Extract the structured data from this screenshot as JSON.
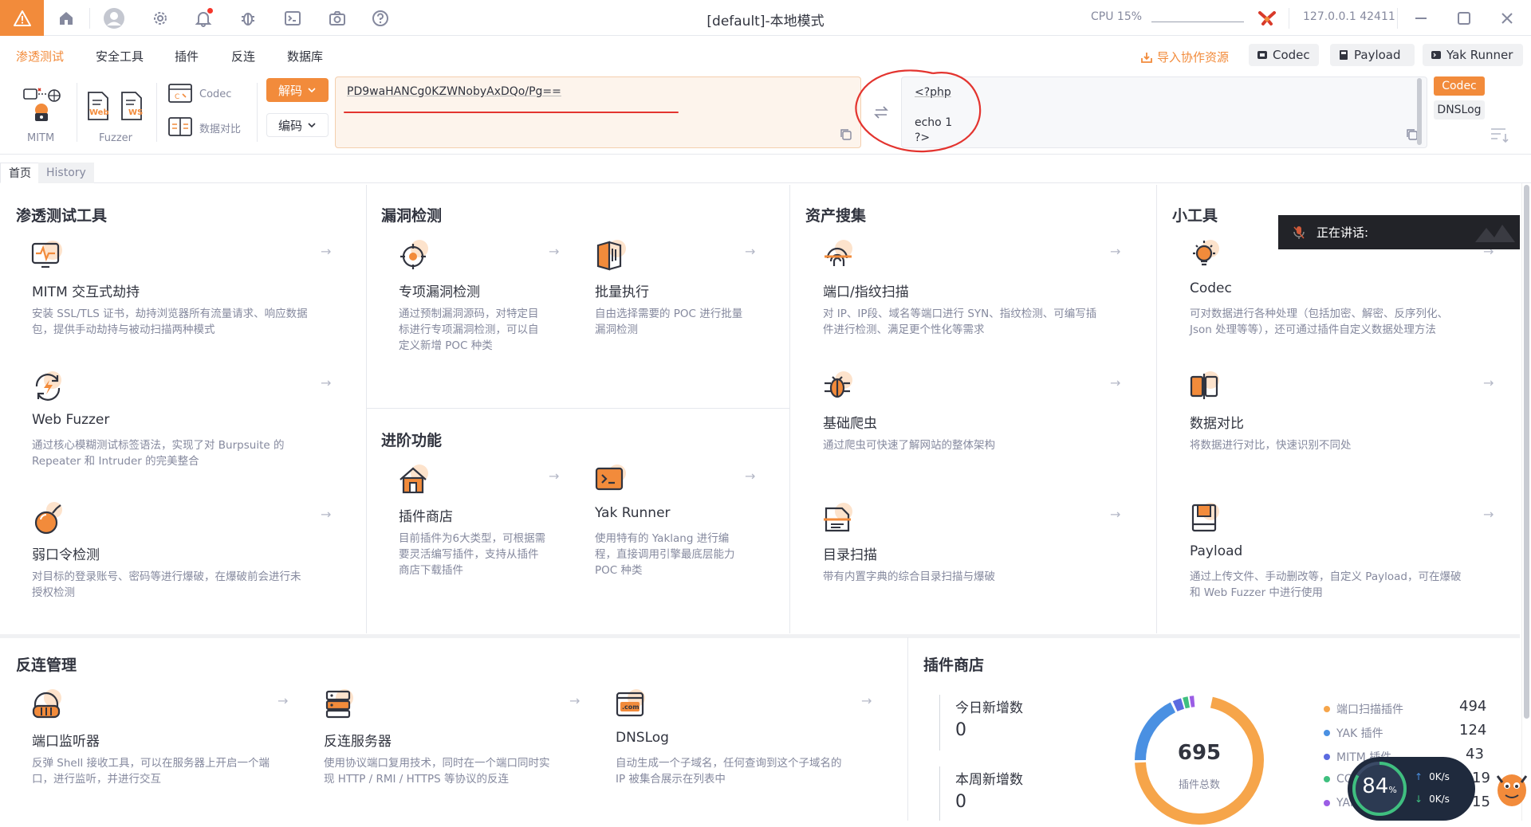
{
  "titlebar": {
    "title": "[default]-本地模式",
    "cpu": "CPU 15%",
    "ip": "127.0.0.1 42411",
    "colors": {
      "accent": "#f28b3b",
      "badge": "#f5362b"
    }
  },
  "menubar": {
    "items": [
      "渗透测试",
      "安全工具",
      "插件",
      "反连",
      "数据库"
    ],
    "import_label": "导入协作资源",
    "right_buttons": [
      "Codec",
      "Payload",
      "Yak Runner"
    ]
  },
  "toolbar": {
    "mitm_label": "MITM",
    "fuzzer_label": "Fuzzer",
    "web_badge": "Web",
    "ws_badge": "WS",
    "codec_label": "Codec",
    "compare_label": "数据对比",
    "decode_btn": "解码",
    "encode_btn": "编码",
    "input_text": "PD9waHANCg0KZWNobyAxDQo/Pg==",
    "output_lines": [
      "<?php",
      "",
      "echo 1",
      "?>"
    ],
    "side_tabs": [
      "Codec",
      "DNSLog"
    ]
  },
  "tabs": [
    "首页",
    "History"
  ],
  "sections": {
    "pentest": {
      "title": "渗透测试工具",
      "cards": [
        {
          "title": "MITM 交互式劫持",
          "desc1": "安装 SSL/TLS 证书，劫持浏览器所有流量请求、响应数据",
          "desc2": "包，提供手动劫持与被动扫描两种模式"
        },
        {
          "title": "Web Fuzzer",
          "desc1": "通过核心模糊测试标签语法，实现了对 Burpsuite 的",
          "desc2": "Repeater 和 Intruder 的完美整合"
        },
        {
          "title": "弱口令检测",
          "desc1": "对目标的登录账号、密码等进行爆破，在爆破前会进行未",
          "desc2": "授权检测"
        }
      ]
    },
    "vuln": {
      "title": "漏洞检测",
      "cards": [
        {
          "title": "专项漏洞检测",
          "desc1": "通过预制漏洞源码，对特定目",
          "desc2": "标进行专项漏洞检测，可以自",
          "desc3": "定义新增 POC 种类"
        },
        {
          "title": "批量执行",
          "desc1": "自由选择需要的 POC 进行批量",
          "desc2": "漏洞检测"
        }
      ]
    },
    "advanced": {
      "title": "进阶功能",
      "cards": [
        {
          "title": "插件商店",
          "desc1": "目前插件为6大类型，可根据需",
          "desc2": "要灵活编写插件，支持从插件",
          "desc3": "商店下载插件"
        },
        {
          "title": "Yak Runner",
          "desc1": "使用特有的 Yaklang 进行编",
          "desc2": "程，直接调用引擎最底层能力",
          "desc3": "POC 种类"
        }
      ]
    },
    "asset": {
      "title": "资产搜集",
      "cards": [
        {
          "title": "端口/指纹扫描",
          "desc1": "对 IP、IP段、域名等端口进行 SYN、指纹检测、可编写插",
          "desc2": "件进行检测、满足更个性化等需求"
        },
        {
          "title": "基础爬虫",
          "desc1": "通过爬虫可快速了解网站的整体架构"
        },
        {
          "title": "目录扫描",
          "desc1": "带有内置字典的综合目录扫描与爆破"
        }
      ]
    },
    "tools": {
      "title": "小工具",
      "cards": [
        {
          "title": "Codec",
          "desc1": "可对数据进行各种处理（包括加密、解密、反序列化、",
          "desc2": "Json 处理等等），还可通过插件自定义数据处理方法"
        },
        {
          "title": "数据对比",
          "desc1": "将数据进行对比，快速识别不同处"
        },
        {
          "title": "Payload",
          "desc1": "通过上传文件、手动删改等，自定义 Payload，可在爆破",
          "desc2": "和 Web Fuzzer 中进行使用"
        }
      ]
    },
    "reverse": {
      "title": "反连管理",
      "cards": [
        {
          "title": "端口监听器",
          "desc1": "反弹 Shell 接收工具，可以在服务器上开启一个端",
          "desc2": "口，进行监听，并进行交互"
        },
        {
          "title": "反连服务器",
          "desc1": "使用协议端口复用技术，同时在一个端口同时实",
          "desc2": "现 HTTP / RMI / HTTPS 等协议的反连"
        },
        {
          "title": "DNSLog",
          "desc1": "自动生成一个子域名，任何查询到这个子域名的",
          "desc2": "IP 被集合展示在列表中"
        }
      ]
    },
    "store": {
      "title": "插件商店",
      "today_label": "今日新增数",
      "today_value": "0",
      "week_label": "本周新增数",
      "week_value": "0",
      "total_value": "695",
      "total_label": "插件总数",
      "legend": [
        {
          "name": "端口扫描插件",
          "value": "494",
          "color": "#f6a54a"
        },
        {
          "name": "YAK 插件",
          "value": "124",
          "color": "#4a90e2"
        },
        {
          "name": "MITM 插件",
          "value": "43",
          "color": "#5b6be0"
        },
        {
          "name": "CODEC",
          "value": "19",
          "color": "#3fbf7f"
        },
        {
          "name": "YAML",
          "value": "15",
          "color": "#9b5de5"
        }
      ]
    }
  },
  "overlay": {
    "speaking": "正在讲话:",
    "net_percent": "84",
    "net_percent_unit": "%",
    "up_speed": "0K/s",
    "down_speed": "0K/s"
  }
}
